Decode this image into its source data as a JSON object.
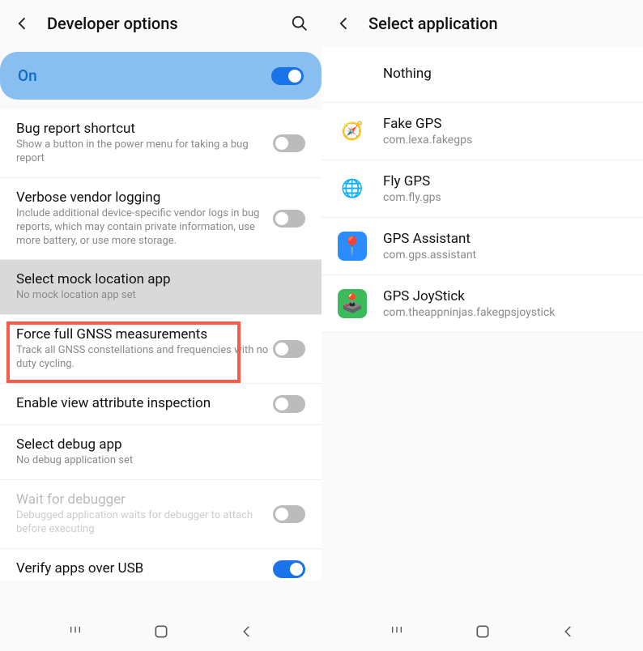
{
  "left": {
    "title": "Developer options",
    "on_label": "On",
    "items": [
      {
        "title": "Bug report shortcut",
        "desc": "Show a button in the power menu for taking a bug report",
        "hasToggle": true
      },
      {
        "title": "Verbose vendor logging",
        "desc": "Include additional device-specific vendor logs in bug reports, which may contain private information, use more battery, or use more storage.",
        "hasToggle": true
      },
      {
        "title": "Select mock location app",
        "desc": "No mock location app set",
        "hasToggle": false,
        "highlighted": true
      },
      {
        "title": "Force full GNSS measurements",
        "desc": "Track all GNSS constellations and frequencies with no duty cycling.",
        "hasToggle": true
      },
      {
        "title": "Enable view attribute inspection",
        "desc": "",
        "hasToggle": true
      },
      {
        "title": "Select debug app",
        "desc": "No debug application set",
        "hasToggle": false
      },
      {
        "title": "Wait for debugger",
        "desc": "Debugged application waits for debugger to attach before executing",
        "hasToggle": true,
        "disabled": true
      },
      {
        "title": "Verify apps over USB",
        "desc": "",
        "hasToggle": true,
        "toggleOn": true,
        "partial": true
      }
    ]
  },
  "right": {
    "title": "Select application",
    "apps": [
      {
        "name": "Nothing",
        "pkg": "",
        "icon": ""
      },
      {
        "name": "Fake GPS",
        "pkg": "com.lexa.fakegps",
        "iconColor": "",
        "iconEmoji": "🧭"
      },
      {
        "name": "Fly GPS",
        "pkg": "com.fly.gps",
        "iconColor": "#fff",
        "iconEmoji": "🌐"
      },
      {
        "name": "GPS Assistant",
        "pkg": "com.gps.assistant",
        "iconColor": "#2a8cff",
        "iconEmoji": "📍"
      },
      {
        "name": "GPS JoyStick",
        "pkg": "com.theappninjas.fakegpsjoystick",
        "iconColor": "#3bbb5c",
        "iconEmoji": "🕹️"
      }
    ]
  }
}
